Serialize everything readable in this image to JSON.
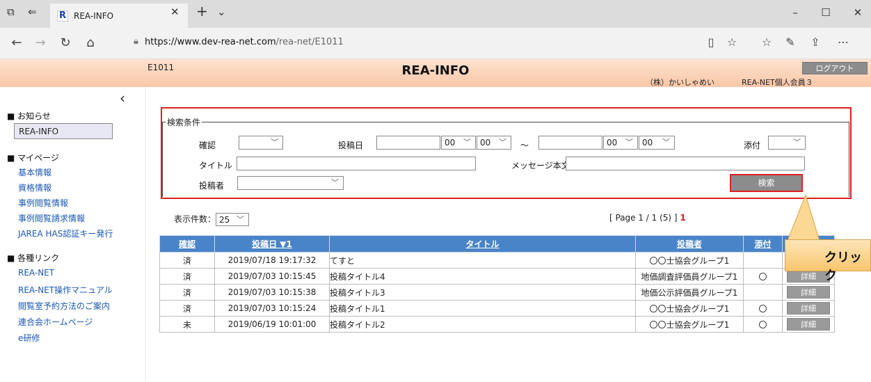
{
  "browser": {
    "tab_title": "REA-INFO",
    "url_host": "https://www.dev-rea-net.com",
    "url_path": "/rea-net/E1011"
  },
  "header": {
    "page_code": "E1011",
    "title": "REA-INFO",
    "logout_label": "ログアウト",
    "company": "（株）かいしゃめい",
    "member": "REA-NET個人会員３"
  },
  "sidebar": {
    "sections": [
      {
        "head": "■ お知らせ",
        "items": [
          "REA-INFO"
        ]
      },
      {
        "head": "■ マイページ",
        "items": [
          "基本情報",
          "資格情報",
          "事例閲覧情報",
          "事例閲覧請求情報",
          "JAREA HAS認証キー発行"
        ]
      },
      {
        "head": "■ 各種リンク",
        "items": [
          "REA-NET",
          "REA-NET操作マニュアル",
          "閲覧室予約方法のご案内",
          "連合会ホームページ",
          "e研修"
        ]
      }
    ]
  },
  "search": {
    "legend": "検索条件",
    "confirm_label": "確認",
    "post_date_label": "投稿日",
    "hour_from": "00",
    "min_from": "00",
    "tilde": "～",
    "hour_to": "00",
    "min_to": "00",
    "attach_label": "添付",
    "title_label": "タイトル",
    "message_label": "メッセージ本文",
    "poster_label": "投稿者",
    "search_button": "検索"
  },
  "list": {
    "count_label": "表示件数：",
    "count_value": "25",
    "page_info": "[ Page 1 / 1 (5) ]",
    "page_current": "1",
    "columns": [
      "確認",
      "投稿日 ▼1",
      "タイトル",
      "投稿者",
      "添付",
      "詳細"
    ],
    "rows": [
      {
        "confirm": "済",
        "date": "2019/07/18 19:17:32",
        "title": "てすと",
        "poster": "〇〇士協会グループ1",
        "attach": "",
        "detail": "詳細"
      },
      {
        "confirm": "済",
        "date": "2019/07/03 10:15:45",
        "title": "投稿タイトル4",
        "poster": "地価調査評価員グループ1",
        "attach": "〇",
        "detail": "詳細"
      },
      {
        "confirm": "済",
        "date": "2019/07/03 10:15:38",
        "title": "投稿タイトル3",
        "poster": "地価公示評価員グループ1",
        "attach": "",
        "detail": "詳細"
      },
      {
        "confirm": "済",
        "date": "2019/07/03 10:15:24",
        "title": "投稿タイトル1",
        "poster": "〇〇士協会グループ1",
        "attach": "〇",
        "detail": "詳細"
      },
      {
        "confirm": "未",
        "date": "2019/06/19 10:01:00",
        "title": "投稿タイトル2",
        "poster": "〇〇士協会グループ1",
        "attach": "〇",
        "detail": "詳細"
      }
    ]
  },
  "callout": {
    "text": "クリック"
  }
}
